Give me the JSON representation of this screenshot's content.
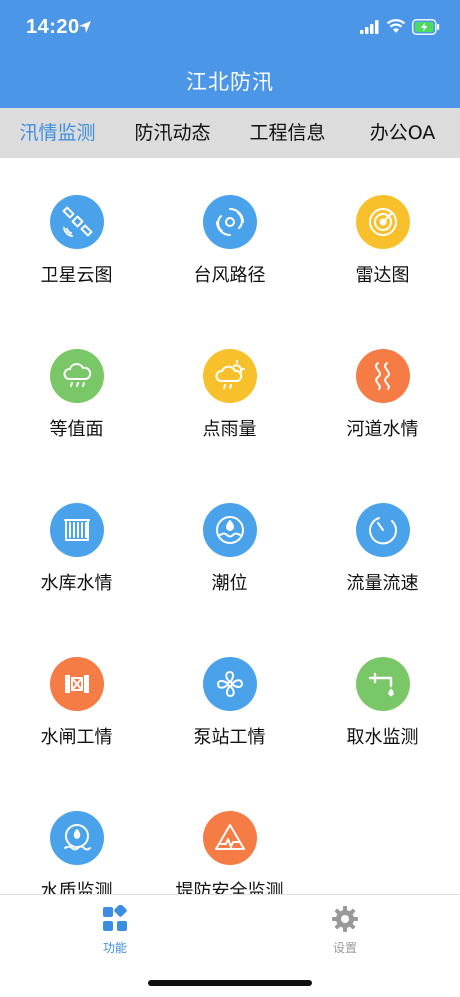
{
  "status_bar": {
    "time": "14:20"
  },
  "header": {
    "title": "江北防汛"
  },
  "tabs": [
    {
      "label": "汛情监测",
      "active": true
    },
    {
      "label": "防汛动态",
      "active": false
    },
    {
      "label": "工程信息",
      "active": false
    },
    {
      "label": "办公OA",
      "active": false
    }
  ],
  "grid": [
    {
      "label": "卫星云图",
      "icon": "satellite-icon",
      "color": "#4aa3ea"
    },
    {
      "label": "台风路径",
      "icon": "typhoon-icon",
      "color": "#4aa3ea"
    },
    {
      "label": "雷达图",
      "icon": "radar-icon",
      "color": "#f8c12c"
    },
    {
      "label": "等值面",
      "icon": "cloud-rain-icon",
      "color": "#7ac768"
    },
    {
      "label": "点雨量",
      "icon": "sun-cloud-rain-icon",
      "color": "#f8c12c"
    },
    {
      "label": "河道水情",
      "icon": "river-icon",
      "color": "#f57c45"
    },
    {
      "label": "水库水情",
      "icon": "reservoir-icon",
      "color": "#4aa3ea"
    },
    {
      "label": "潮位",
      "icon": "tide-icon",
      "color": "#4aa3ea"
    },
    {
      "label": "流量流速",
      "icon": "gauge-icon",
      "color": "#4aa3ea"
    },
    {
      "label": "水闸工情",
      "icon": "sluice-gate-icon",
      "color": "#f57c45"
    },
    {
      "label": "泵站工情",
      "icon": "fan-icon",
      "color": "#4aa3ea"
    },
    {
      "label": "取水监测",
      "icon": "faucet-icon",
      "color": "#7ac768"
    },
    {
      "label": "水质监测",
      "icon": "water-drop-wave-icon",
      "color": "#4aa3ea"
    },
    {
      "label": "堤防安全监测",
      "icon": "warning-triangle-icon",
      "color": "#f57c45"
    }
  ],
  "tabbar": [
    {
      "label": "功能",
      "icon": "grid-diamond-icon",
      "active": true,
      "color": "#3d8ee0"
    },
    {
      "label": "设置",
      "icon": "gear-icon",
      "active": false,
      "color": "#999999"
    }
  ]
}
